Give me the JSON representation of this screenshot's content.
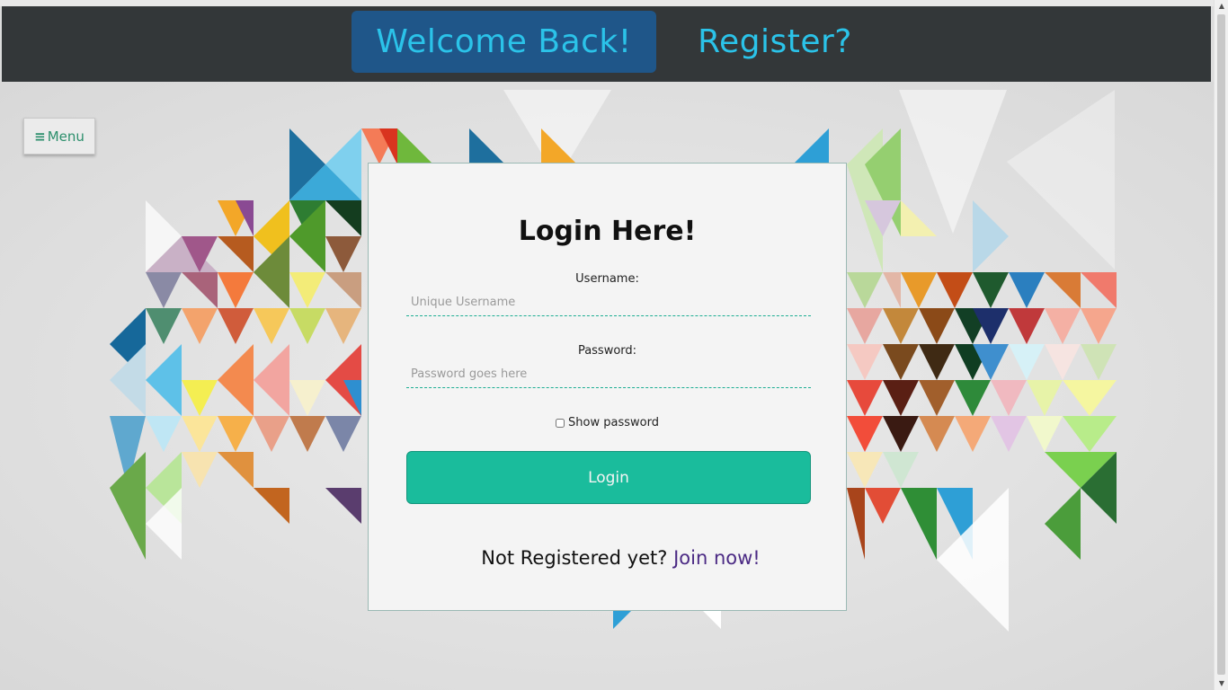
{
  "header": {
    "tabs": [
      {
        "label": "Welcome Back!",
        "active": true
      },
      {
        "label": "Register?",
        "active": false
      }
    ]
  },
  "menu": {
    "icon": "hamburger-icon",
    "label": "Menu"
  },
  "login": {
    "title": "Login Here!",
    "username_label": "Username:",
    "username_placeholder": "Unique Username",
    "username_value": "",
    "password_label": "Password:",
    "password_placeholder": "Password goes here",
    "password_value": "",
    "show_password_label": "Show password",
    "show_password_checked": false,
    "login_button": "Login",
    "not_registered_text": "Not Registered yet?",
    "join_link": "Join now!"
  },
  "colors": {
    "header_bg": "#333739",
    "active_tab_bg": "#1f5689",
    "tab_text": "#2bc3e9",
    "accent": "#1abc9c",
    "join_link": "#4b2a84",
    "menu_text": "#2c8f6c"
  }
}
